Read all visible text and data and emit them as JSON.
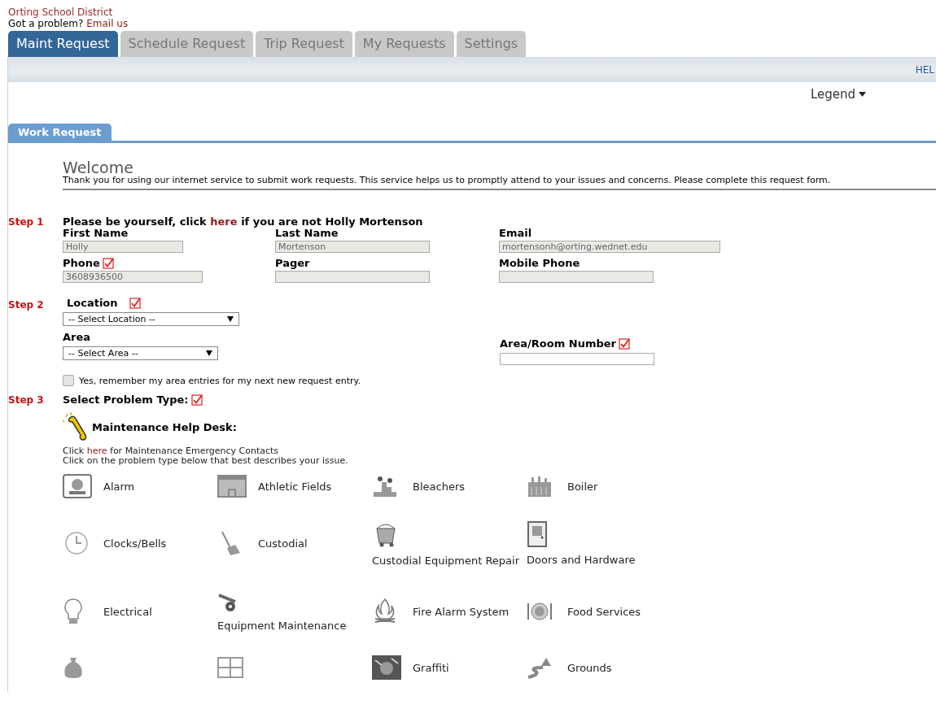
{
  "org_name": "Orting School District",
  "contact": {
    "text": "Got a problem?",
    "link": "Email us"
  },
  "tabs": [
    {
      "label": "Maint Request",
      "selected": true
    },
    {
      "label": "Schedule Request",
      "selected": false
    },
    {
      "label": "Trip Request",
      "selected": false
    },
    {
      "label": "My Requests",
      "selected": false
    },
    {
      "label": "Settings",
      "selected": false
    }
  ],
  "toolbar": {
    "help": "HEL"
  },
  "legend": "Legend",
  "section_tab": "Work Request",
  "welcome": {
    "title": "Welcome",
    "text": "Thank you for using our internet service to submit work requests. This service helps us to promptly attend to your issues and concerns. Please complete this request form."
  },
  "step1": {
    "label": "Step 1",
    "before": "Please be yourself, click",
    "link": "here",
    "after": "if you are not Holly Mortenson",
    "fields": [
      {
        "label": "First Name",
        "value": "Holly",
        "required": false
      },
      {
        "label": "Last Name",
        "value": "Mortenson",
        "required": false
      },
      {
        "label": "Email",
        "value": "mortensonh@orting.wednet.edu",
        "required": false
      },
      {
        "label": "Phone",
        "value": "3608936500",
        "required": true
      },
      {
        "label": "Pager",
        "required": false
      },
      {
        "label": "Mobile Phone",
        "required": false
      }
    ]
  },
  "step2": {
    "label": "Step 2",
    "location": {
      "label": "Location",
      "required": true,
      "placeholder": "-- Select Location --"
    },
    "area": {
      "label": "Area",
      "required": false,
      "placeholder": "-- Select Area --"
    },
    "room": {
      "label": "Area/Room Number",
      "required": true
    },
    "remember": {
      "label": "Yes, remember my area entries for my next new request entry.",
      "checked": false
    }
  },
  "step3": {
    "label": "Step 3",
    "title": "Select Problem Type:",
    "required": true,
    "help_desk": "Maintenance Help Desk:",
    "contacts": {
      "before": "Click",
      "link": "here",
      "after": "for Maintenance Emergency Contacts"
    },
    "instruction": "Click on the problem type below that best describes your issue.",
    "problem_types": [
      {
        "label": "Alarm",
        "kind": "beside"
      },
      {
        "label": "Athletic Fields",
        "kind": "beside"
      },
      {
        "label": "Bleachers",
        "kind": "beside"
      },
      {
        "label": "Boiler",
        "kind": "beside"
      },
      {
        "label": "Clocks/Bells",
        "kind": "beside"
      },
      {
        "label": "Custodial",
        "kind": "beside"
      },
      {
        "label": "Custodial Equipment Repair",
        "kind": "below"
      },
      {
        "label": "Doors and Hardware",
        "kind": "below"
      },
      {
        "label": "Electrical",
        "kind": "beside"
      },
      {
        "label": "Equipment Maintenance",
        "kind": "below"
      },
      {
        "label": "Fire Alarm System",
        "kind": "beside"
      },
      {
        "label": "Food Services",
        "kind": "beside"
      },
      {
        "kind": "below"
      },
      {
        "kind": "below"
      },
      {
        "label": "Graffiti",
        "kind": "beside"
      },
      {
        "label": "Grounds",
        "kind": "beside"
      }
    ]
  }
}
